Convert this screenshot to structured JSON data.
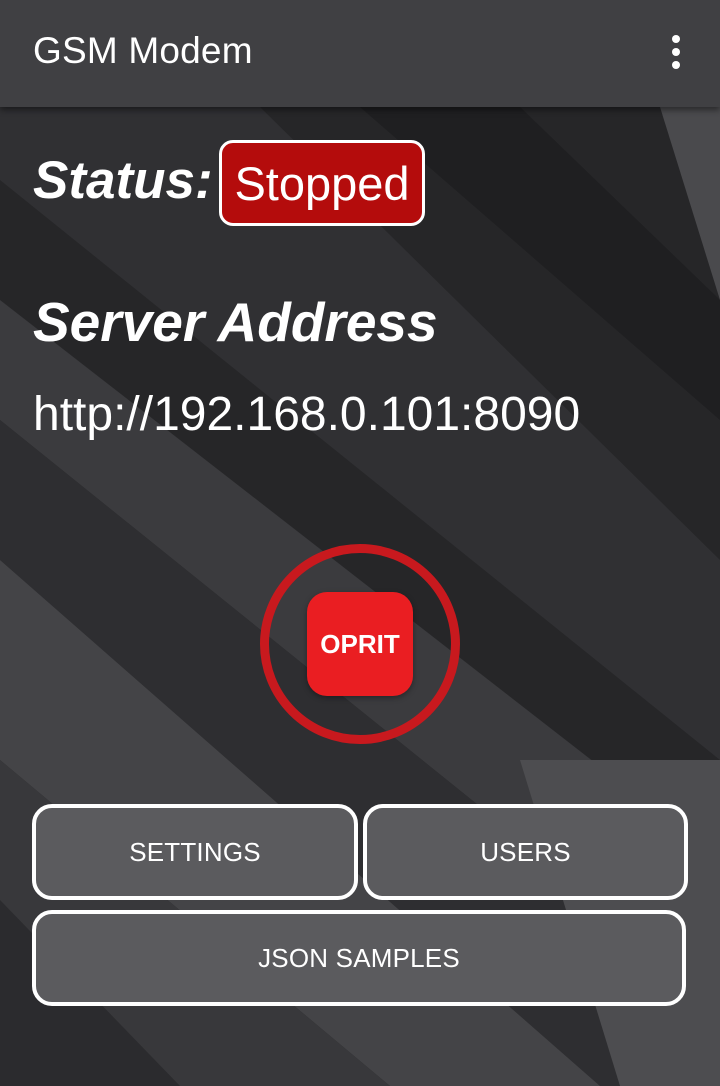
{
  "app": {
    "title": "GSM Modem",
    "menu_icon": "more-vert-icon"
  },
  "status": {
    "label": "Status:",
    "value": "Stopped",
    "color": "#b40c0c"
  },
  "server": {
    "title": "Server Address",
    "url": "http://192.168.0.101:8090"
  },
  "control": {
    "stop_label": "OPRIT",
    "button_color": "#ea1e22",
    "ring_color": "#c8191e"
  },
  "actions": {
    "settings_label": "SETTINGS",
    "users_label": "USERS",
    "json_samples_label": "JSON SAMPLES"
  }
}
